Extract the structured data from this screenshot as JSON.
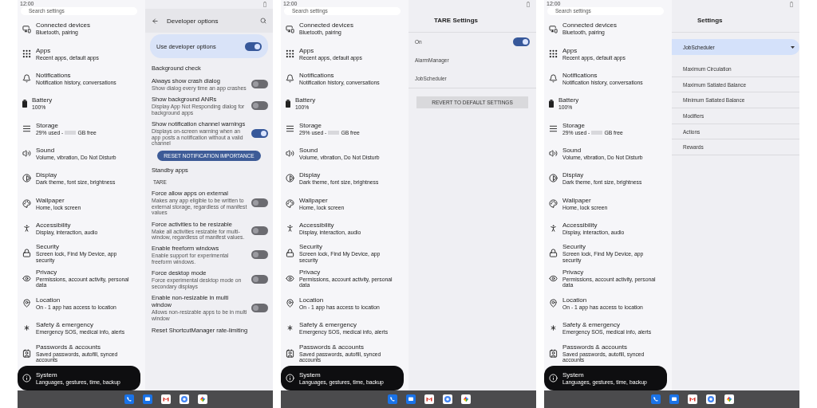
{
  "screens": [
    {
      "status_time": "12:00",
      "search": {
        "placeholder": "Search settings"
      },
      "settings_items": [
        {
          "title": "Connected devices",
          "subtitle": "Bluetooth, pairing",
          "selected": false
        },
        {
          "title": "Apps",
          "subtitle": "Recent apps, default apps",
          "selected": false
        },
        {
          "title": "Notifications",
          "subtitle": "Notification history, conversations",
          "selected": false
        },
        {
          "title": "Battery",
          "subtitle": "100%",
          "selected": false
        },
        {
          "title": "Storage",
          "subtitle": "29% used -",
          "subtitle_after": "GB free",
          "redacted": true,
          "selected": false
        },
        {
          "title": "Sound",
          "subtitle": "Volume, vibration, Do Not Disturb",
          "selected": false
        },
        {
          "title": "Display",
          "subtitle": "Dark theme, font size, brightness",
          "selected": false
        },
        {
          "title": "Wallpaper",
          "subtitle": "Home, lock screen",
          "selected": false
        },
        {
          "title": "Accessibility",
          "subtitle": "Display, interaction, audio",
          "selected": false
        },
        {
          "title": "Security",
          "subtitle": "Screen lock, Find My Device, app security",
          "selected": false
        },
        {
          "title": "Privacy",
          "subtitle": "Permissions, account activity, personal data",
          "selected": false
        },
        {
          "title": "Location",
          "subtitle": "On - 1 app has access to location",
          "selected": false
        },
        {
          "title": "Safety & emergency",
          "subtitle": "Emergency SOS, medical info, alerts",
          "selected": false
        },
        {
          "title": "Passwords & accounts",
          "subtitle": "Saved passwords, autofill, synced accounts",
          "selected": false
        },
        {
          "title": "System",
          "subtitle": "Languages, gestures, time, backup",
          "selected": true
        }
      ],
      "detail": {
        "kind": "developer_options",
        "title": "Developer options",
        "master": {
          "title": "Use developer options",
          "on": true
        },
        "rows": [
          {
            "kind": "plain",
            "title": "Background check"
          },
          {
            "kind": "switch",
            "title": "Always show crash dialog",
            "subtitle": "Show dialog every time an app crashes",
            "on": false
          },
          {
            "kind": "switch",
            "title": "Show background ANRs",
            "subtitle": "Display App Not Responding dialog for background apps",
            "on": false
          },
          {
            "kind": "switch",
            "title": "Show notification channel warnings",
            "subtitle": "Displays on-screen warning when an app posts a notification without a valid channel",
            "on": true
          },
          {
            "kind": "action",
            "title": "RESET NOTIFICATION IMPORTANCE"
          },
          {
            "kind": "plain",
            "title": "Standby apps"
          },
          {
            "kind": "category",
            "title": "TARE"
          },
          {
            "kind": "switch",
            "title": "Force allow apps on external",
            "subtitle": "Makes any app eligible to be written to external storage, regardless of manifest values",
            "on": false
          },
          {
            "kind": "switch",
            "title": "Force activities to be resizable",
            "subtitle": "Make all activities resizable for multi-window, regardless of manifest values.",
            "on": false
          },
          {
            "kind": "switch",
            "title": "Enable freeform windows",
            "subtitle": "Enable support for experimental freeform windows.",
            "on": false
          },
          {
            "kind": "switch",
            "title": "Force desktop mode",
            "subtitle": "Force experimental desktop mode on secondary displays",
            "on": false
          },
          {
            "kind": "switch",
            "title": "Enable non-resizable in multi window",
            "subtitle": "Allows non-resizable apps to be in multi window",
            "on": false
          },
          {
            "kind": "plain",
            "title": "Reset ShortcutManager rate-limiting"
          }
        ]
      }
    },
    {
      "status_time": "12:00",
      "search": {
        "placeholder": "Search settings"
      },
      "settings_items": [
        {
          "title": "Connected devices",
          "subtitle": "Bluetooth, pairing",
          "selected": false
        },
        {
          "title": "Apps",
          "subtitle": "Recent apps, default apps",
          "selected": false
        },
        {
          "title": "Notifications",
          "subtitle": "Notification history, conversations",
          "selected": false
        },
        {
          "title": "Battery",
          "subtitle": "100%",
          "selected": false
        },
        {
          "title": "Storage",
          "subtitle": "29% used -",
          "subtitle_after": "GB free",
          "redacted": true,
          "selected": false
        },
        {
          "title": "Sound",
          "subtitle": "Volume, vibration, Do Not Disturb",
          "selected": false
        },
        {
          "title": "Display",
          "subtitle": "Dark theme, font size, brightness",
          "selected": false
        },
        {
          "title": "Wallpaper",
          "subtitle": "Home, lock screen",
          "selected": false
        },
        {
          "title": "Accessibility",
          "subtitle": "Display, interaction, audio",
          "selected": false
        },
        {
          "title": "Security",
          "subtitle": "Screen lock, Find My Device, app security",
          "selected": false
        },
        {
          "title": "Privacy",
          "subtitle": "Permissions, account activity, personal data",
          "selected": false
        },
        {
          "title": "Location",
          "subtitle": "On - 1 app has access to location",
          "selected": false
        },
        {
          "title": "Safety & emergency",
          "subtitle": "Emergency SOS, medical info, alerts",
          "selected": false
        },
        {
          "title": "Passwords & accounts",
          "subtitle": "Saved passwords, autofill, synced accounts",
          "selected": false
        },
        {
          "title": "System",
          "subtitle": "Languages, gestures, time, backup",
          "selected": true
        }
      ],
      "detail": {
        "kind": "tare",
        "title": "TARE Settings",
        "rows": [
          {
            "kind": "switch",
            "title": "On",
            "on": true
          },
          {
            "kind": "plain",
            "title": "AlarmManager"
          },
          {
            "kind": "plain",
            "title": "JobScheduler"
          }
        ],
        "button": "REVERT TO DEFAULT SETTINGS"
      }
    },
    {
      "status_time": "12:00",
      "search": {
        "placeholder": "Search settings"
      },
      "settings_items": [
        {
          "title": "Connected devices",
          "subtitle": "Bluetooth, pairing",
          "selected": false
        },
        {
          "title": "Apps",
          "subtitle": "Recent apps, default apps",
          "selected": false
        },
        {
          "title": "Notifications",
          "subtitle": "Notification history, conversations",
          "selected": false
        },
        {
          "title": "Battery",
          "subtitle": "100%",
          "selected": false
        },
        {
          "title": "Storage",
          "subtitle": "29% used -",
          "subtitle_after": "GB free",
          "redacted": true,
          "selected": false
        },
        {
          "title": "Sound",
          "subtitle": "Volume, vibration, Do Not Disturb",
          "selected": false
        },
        {
          "title": "Display",
          "subtitle": "Dark theme, font size, brightness",
          "selected": false
        },
        {
          "title": "Wallpaper",
          "subtitle": "Home, lock screen",
          "selected": false
        },
        {
          "title": "Accessibility",
          "subtitle": "Display, interaction, audio",
          "selected": false
        },
        {
          "title": "Security",
          "subtitle": "Screen lock, Find My Device, app security",
          "selected": false
        },
        {
          "title": "Privacy",
          "subtitle": "Permissions, account activity, personal data",
          "selected": false
        },
        {
          "title": "Location",
          "subtitle": "On - 1 app has access to location",
          "selected": false
        },
        {
          "title": "Safety & emergency",
          "subtitle": "Emergency SOS, medical info, alerts",
          "selected": false
        },
        {
          "title": "Passwords & accounts",
          "subtitle": "Saved passwords, autofill, synced accounts",
          "selected": false
        },
        {
          "title": "System",
          "subtitle": "Languages, gestures, time, backup",
          "selected": true
        }
      ],
      "detail": {
        "kind": "policy",
        "title": "Settings",
        "dropdown": "JobScheduler",
        "items": [
          "Maximum Circulation",
          "Maximum Satiated Balance",
          "Minimum Satiated Balance",
          "Modifiers",
          "Actions",
          "Rewards"
        ]
      }
    }
  ]
}
